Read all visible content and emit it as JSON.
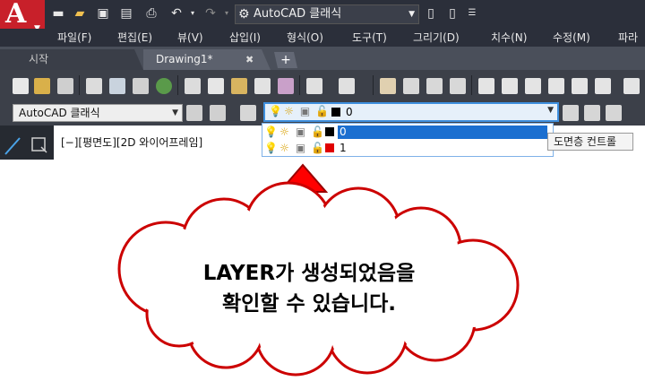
{
  "titlebar": {
    "app_logo": "A",
    "workspace": "AutoCAD 클래식",
    "icons": [
      "new-icon",
      "open-icon",
      "save-icon",
      "save-as-icon",
      "plot-icon",
      "undo-icon",
      "redo-icon",
      "workspace-gear-icon",
      "share-icon",
      "export-icon",
      "customize-icon"
    ]
  },
  "menu": {
    "items": [
      "파일(F)",
      "편집(E)",
      "뷰(V)",
      "삽입(I)",
      "형식(O)",
      "도구(T)",
      "그리기(D)",
      "치수(N)",
      "수정(M)",
      "파라"
    ]
  },
  "tabs": [
    {
      "label": "시작"
    },
    {
      "label": "Drawing1*"
    }
  ],
  "toolbar2": {
    "workspace_select": "AutoCAD 클래식",
    "current_layer": "0"
  },
  "layers": [
    {
      "name": "0",
      "color": "#000000"
    },
    {
      "name": "1",
      "color": "#e00000"
    }
  ],
  "tooltip": "도면층 컨트롤",
  "viewport_label": "[−][평면도][2D 와이어프레임]",
  "callout": {
    "line1": "LAYER가 생성되었음을",
    "line2": "확인할 수 있습니다.",
    "arrow_color": "#ff0000"
  }
}
